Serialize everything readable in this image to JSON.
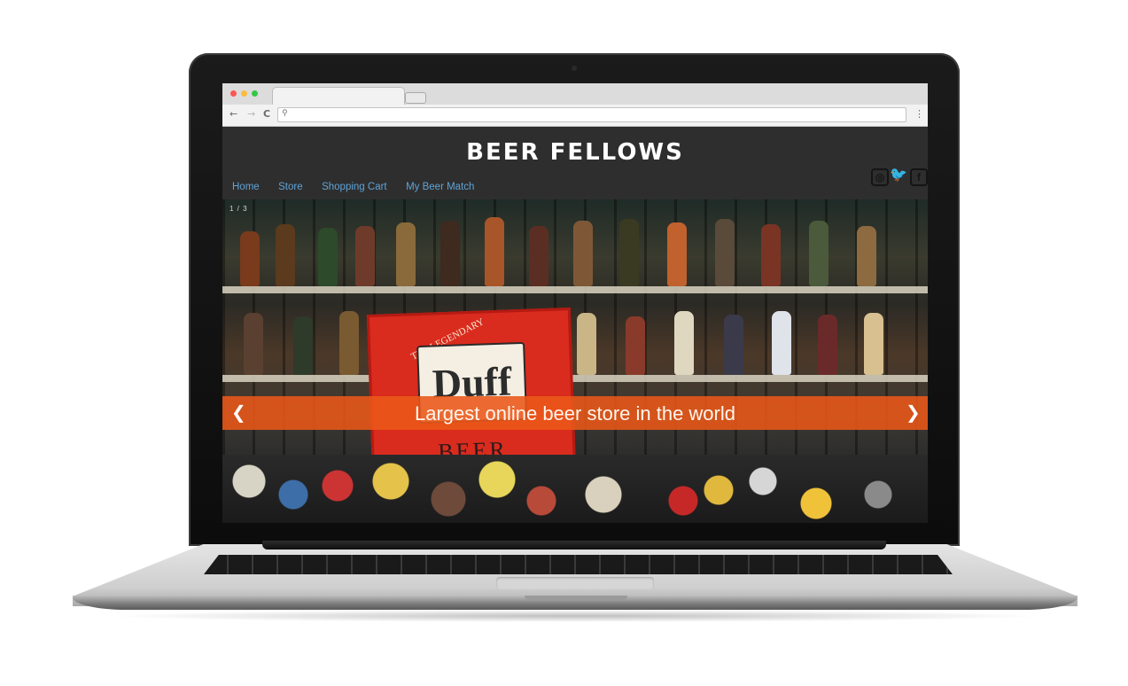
{
  "browser": {
    "back_icon": "←",
    "forward_icon": "→",
    "reload_icon": "C",
    "search_icon": "⚲",
    "menu_icon": "⋮",
    "url": ""
  },
  "site": {
    "brand": "BEER FELLOWS",
    "nav": [
      {
        "label": "Home"
      },
      {
        "label": "Store"
      },
      {
        "label": "Shopping Cart"
      },
      {
        "label": "My Beer Match"
      }
    ],
    "social": [
      "instagram-icon",
      "twitter-icon",
      "facebook-icon"
    ]
  },
  "hero": {
    "counter": "1 / 3",
    "caption": "Largest online beer store in the world",
    "prev_arrow": "❮",
    "next_arrow": "❯",
    "sign_top": "THE LEGENDARY",
    "sign_logo": "Duff",
    "sign_bottom": "BEER"
  },
  "colors": {
    "header_bg": "#2e2e2e",
    "nav_link": "#5fa3d6",
    "caption_band": "#ea5818"
  }
}
